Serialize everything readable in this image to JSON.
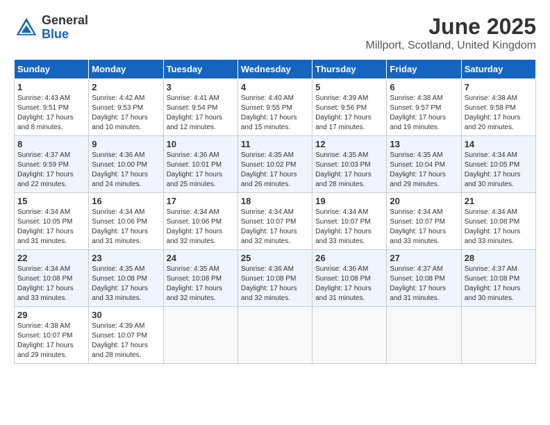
{
  "logo": {
    "general": "General",
    "blue": "Blue"
  },
  "title": "June 2025",
  "location": "Millport, Scotland, United Kingdom",
  "weekdays": [
    "Sunday",
    "Monday",
    "Tuesday",
    "Wednesday",
    "Thursday",
    "Friday",
    "Saturday"
  ],
  "weeks": [
    [
      {
        "day": "1",
        "sunrise": "4:43 AM",
        "sunset": "9:51 PM",
        "daylight": "17 hours and 8 minutes."
      },
      {
        "day": "2",
        "sunrise": "4:42 AM",
        "sunset": "9:53 PM",
        "daylight": "17 hours and 10 minutes."
      },
      {
        "day": "3",
        "sunrise": "4:41 AM",
        "sunset": "9:54 PM",
        "daylight": "17 hours and 12 minutes."
      },
      {
        "day": "4",
        "sunrise": "4:40 AM",
        "sunset": "9:55 PM",
        "daylight": "17 hours and 15 minutes."
      },
      {
        "day": "5",
        "sunrise": "4:39 AM",
        "sunset": "9:56 PM",
        "daylight": "17 hours and 17 minutes."
      },
      {
        "day": "6",
        "sunrise": "4:38 AM",
        "sunset": "9:57 PM",
        "daylight": "17 hours and 19 minutes."
      },
      {
        "day": "7",
        "sunrise": "4:38 AM",
        "sunset": "9:58 PM",
        "daylight": "17 hours and 20 minutes."
      }
    ],
    [
      {
        "day": "8",
        "sunrise": "4:37 AM",
        "sunset": "9:59 PM",
        "daylight": "17 hours and 22 minutes."
      },
      {
        "day": "9",
        "sunrise": "4:36 AM",
        "sunset": "10:00 PM",
        "daylight": "17 hours and 24 minutes."
      },
      {
        "day": "10",
        "sunrise": "4:36 AM",
        "sunset": "10:01 PM",
        "daylight": "17 hours and 25 minutes."
      },
      {
        "day": "11",
        "sunrise": "4:35 AM",
        "sunset": "10:02 PM",
        "daylight": "17 hours and 26 minutes."
      },
      {
        "day": "12",
        "sunrise": "4:35 AM",
        "sunset": "10:03 PM",
        "daylight": "17 hours and 28 minutes."
      },
      {
        "day": "13",
        "sunrise": "4:35 AM",
        "sunset": "10:04 PM",
        "daylight": "17 hours and 29 minutes."
      },
      {
        "day": "14",
        "sunrise": "4:34 AM",
        "sunset": "10:05 PM",
        "daylight": "17 hours and 30 minutes."
      }
    ],
    [
      {
        "day": "15",
        "sunrise": "4:34 AM",
        "sunset": "10:05 PM",
        "daylight": "17 hours and 31 minutes."
      },
      {
        "day": "16",
        "sunrise": "4:34 AM",
        "sunset": "10:06 PM",
        "daylight": "17 hours and 31 minutes."
      },
      {
        "day": "17",
        "sunrise": "4:34 AM",
        "sunset": "10:06 PM",
        "daylight": "17 hours and 32 minutes."
      },
      {
        "day": "18",
        "sunrise": "4:34 AM",
        "sunset": "10:07 PM",
        "daylight": "17 hours and 32 minutes."
      },
      {
        "day": "19",
        "sunrise": "4:34 AM",
        "sunset": "10:07 PM",
        "daylight": "17 hours and 33 minutes."
      },
      {
        "day": "20",
        "sunrise": "4:34 AM",
        "sunset": "10:07 PM",
        "daylight": "17 hours and 33 minutes."
      },
      {
        "day": "21",
        "sunrise": "4:34 AM",
        "sunset": "10:08 PM",
        "daylight": "17 hours and 33 minutes."
      }
    ],
    [
      {
        "day": "22",
        "sunrise": "4:34 AM",
        "sunset": "10:08 PM",
        "daylight": "17 hours and 33 minutes."
      },
      {
        "day": "23",
        "sunrise": "4:35 AM",
        "sunset": "10:08 PM",
        "daylight": "17 hours and 33 minutes."
      },
      {
        "day": "24",
        "sunrise": "4:35 AM",
        "sunset": "10:08 PM",
        "daylight": "17 hours and 32 minutes."
      },
      {
        "day": "25",
        "sunrise": "4:36 AM",
        "sunset": "10:08 PM",
        "daylight": "17 hours and 32 minutes."
      },
      {
        "day": "26",
        "sunrise": "4:36 AM",
        "sunset": "10:08 PM",
        "daylight": "17 hours and 31 minutes."
      },
      {
        "day": "27",
        "sunrise": "4:37 AM",
        "sunset": "10:08 PM",
        "daylight": "17 hours and 31 minutes."
      },
      {
        "day": "28",
        "sunrise": "4:37 AM",
        "sunset": "10:08 PM",
        "daylight": "17 hours and 30 minutes."
      }
    ],
    [
      {
        "day": "29",
        "sunrise": "4:38 AM",
        "sunset": "10:07 PM",
        "daylight": "17 hours and 29 minutes."
      },
      {
        "day": "30",
        "sunrise": "4:39 AM",
        "sunset": "10:07 PM",
        "daylight": "17 hours and 28 minutes."
      },
      null,
      null,
      null,
      null,
      null
    ]
  ]
}
